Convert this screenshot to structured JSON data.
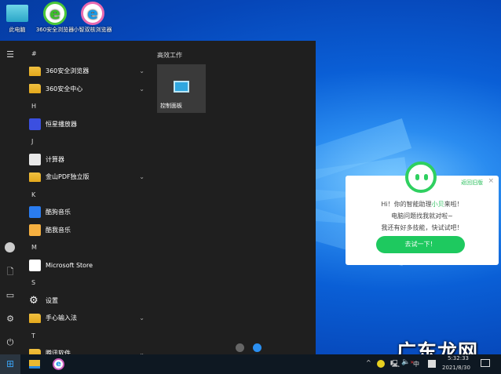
{
  "desktop": {
    "icons": [
      {
        "label": "此电脑",
        "icon": "computer-icon"
      },
      {
        "label": "360安全浏览器",
        "icon": "360-browser-icon"
      },
      {
        "label": "小智双核浏览器",
        "icon": "xiaozhi-browser-icon"
      }
    ]
  },
  "start_menu": {
    "list": [
      {
        "type": "letter",
        "label": "#"
      },
      {
        "type": "app",
        "label": "360安全浏览器",
        "icon": "folder-icon",
        "expand": true
      },
      {
        "type": "app",
        "label": "360安全中心",
        "icon": "folder-icon",
        "expand": true
      },
      {
        "type": "letter",
        "label": "H"
      },
      {
        "type": "app",
        "label": "恒星播放器",
        "icon": "player-icon"
      },
      {
        "type": "letter",
        "label": "J"
      },
      {
        "type": "app",
        "label": "计算器",
        "icon": "calculator-icon"
      },
      {
        "type": "app",
        "label": "金山PDF独立版",
        "icon": "folder-icon",
        "expand": true
      },
      {
        "type": "letter",
        "label": "K"
      },
      {
        "type": "app",
        "label": "酷狗音乐",
        "icon": "kugou-icon"
      },
      {
        "type": "app",
        "label": "酷我音乐",
        "icon": "kuwo-icon"
      },
      {
        "type": "letter",
        "label": "M"
      },
      {
        "type": "app",
        "label": "Microsoft Store",
        "icon": "store-icon"
      },
      {
        "type": "letter",
        "label": "S"
      },
      {
        "type": "app",
        "label": "设置",
        "icon": "gear-icon"
      },
      {
        "type": "app",
        "label": "手心输入法",
        "icon": "folder-icon",
        "expand": true
      },
      {
        "type": "letter",
        "label": "T"
      },
      {
        "type": "app",
        "label": "腾讯软件",
        "icon": "folder-icon",
        "expand": true
      }
    ],
    "tiles_group": "高效工作",
    "tile": {
      "label": "控制面板"
    }
  },
  "popup": {
    "line1_pre": "Hi！你的智能助理",
    "line1_name": "小贝",
    "line1_post": "来啦！",
    "line2": "电脑问题找我就对啦~",
    "line3": "我还有好多技能，快试试吧！",
    "button": "去试一下！",
    "back_link": "返回旧版",
    "accent": "#1ec95f"
  },
  "taskbar": {
    "ime": "中",
    "time": "5:32:33",
    "date": "2021/8/30"
  },
  "watermark": "广东龙网"
}
